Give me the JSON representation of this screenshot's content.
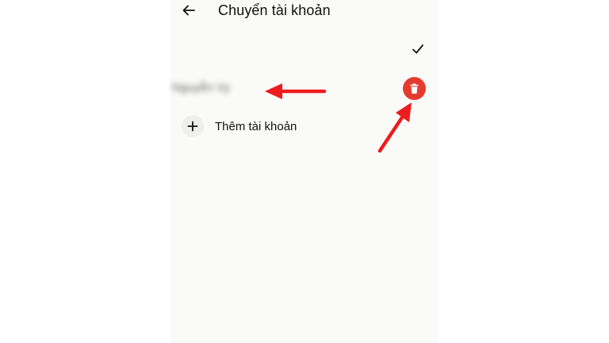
{
  "header": {
    "back_icon": "arrow-left-icon",
    "title": "Chuyển tài khoản"
  },
  "current_account": {
    "name": "Nguyễn Vy",
    "selected": true,
    "selected_icon": "checkmark-icon",
    "delete_icon": "trash-icon",
    "delete_color": "#e43b2f"
  },
  "add_account": {
    "icon": "plus-icon",
    "label": "Thêm tài khoản"
  },
  "annotations": {
    "arrow_color": "#ee1c1c",
    "arrows": [
      {
        "points_to": "account-name"
      },
      {
        "points_to": "delete-account-button"
      }
    ]
  }
}
